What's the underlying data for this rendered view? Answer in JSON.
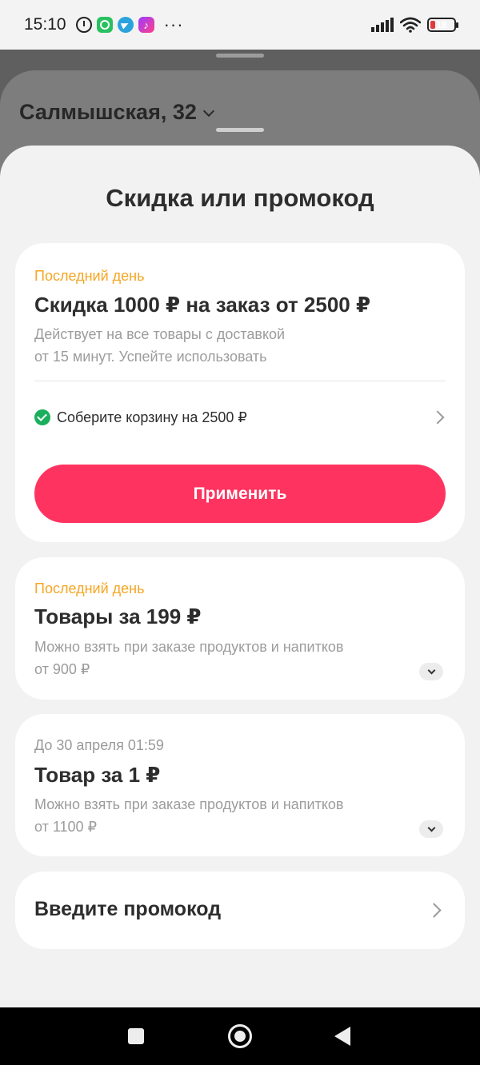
{
  "status_bar": {
    "time": "15:10",
    "battery": "18",
    "battery_level": 0.18,
    "battery_color": "#e03b3b",
    "icons": [
      "alarm-icon",
      "whatsapp-icon",
      "telegram-icon",
      "music-app-icon",
      "more-dots-icon",
      "signal-icon",
      "wifi-icon",
      "battery-icon"
    ],
    "more_dots": "···"
  },
  "background": {
    "address": "Салмышская, 32"
  },
  "sheet": {
    "title": "Скидка или промокод",
    "offers": [
      {
        "tag": "Последний день",
        "tag_color": "#f5a623",
        "title": "Скидка 1000 ₽ на заказ от 2500 ₽",
        "description_line1": "Действует на все товары с доставкой",
        "description_line2": "от 15 минут. Успейте использовать",
        "condition": "Соберите корзину на 2500 ₽",
        "condition_status": "done",
        "button": "Применить",
        "button_color": "#ff335f"
      },
      {
        "tag": "Последний день",
        "tag_color": "#f5a623",
        "title": "Товары за 199 ₽",
        "description_line1": "Можно взять при заказе продуктов и напитков",
        "description_line2": "от 900 ₽"
      },
      {
        "tag": "До 30 апреля 01:59",
        "tag_color": "#9a9a9a",
        "title": "Товар за 1 ₽",
        "description_line1": "Можно взять при заказе продуктов и напитков",
        "description_line2": "от 1100 ₽"
      }
    ],
    "promo_input_label": "Введите промокод"
  },
  "nav": {
    "icons": [
      "recent-apps-icon",
      "home-icon",
      "back-icon"
    ]
  }
}
